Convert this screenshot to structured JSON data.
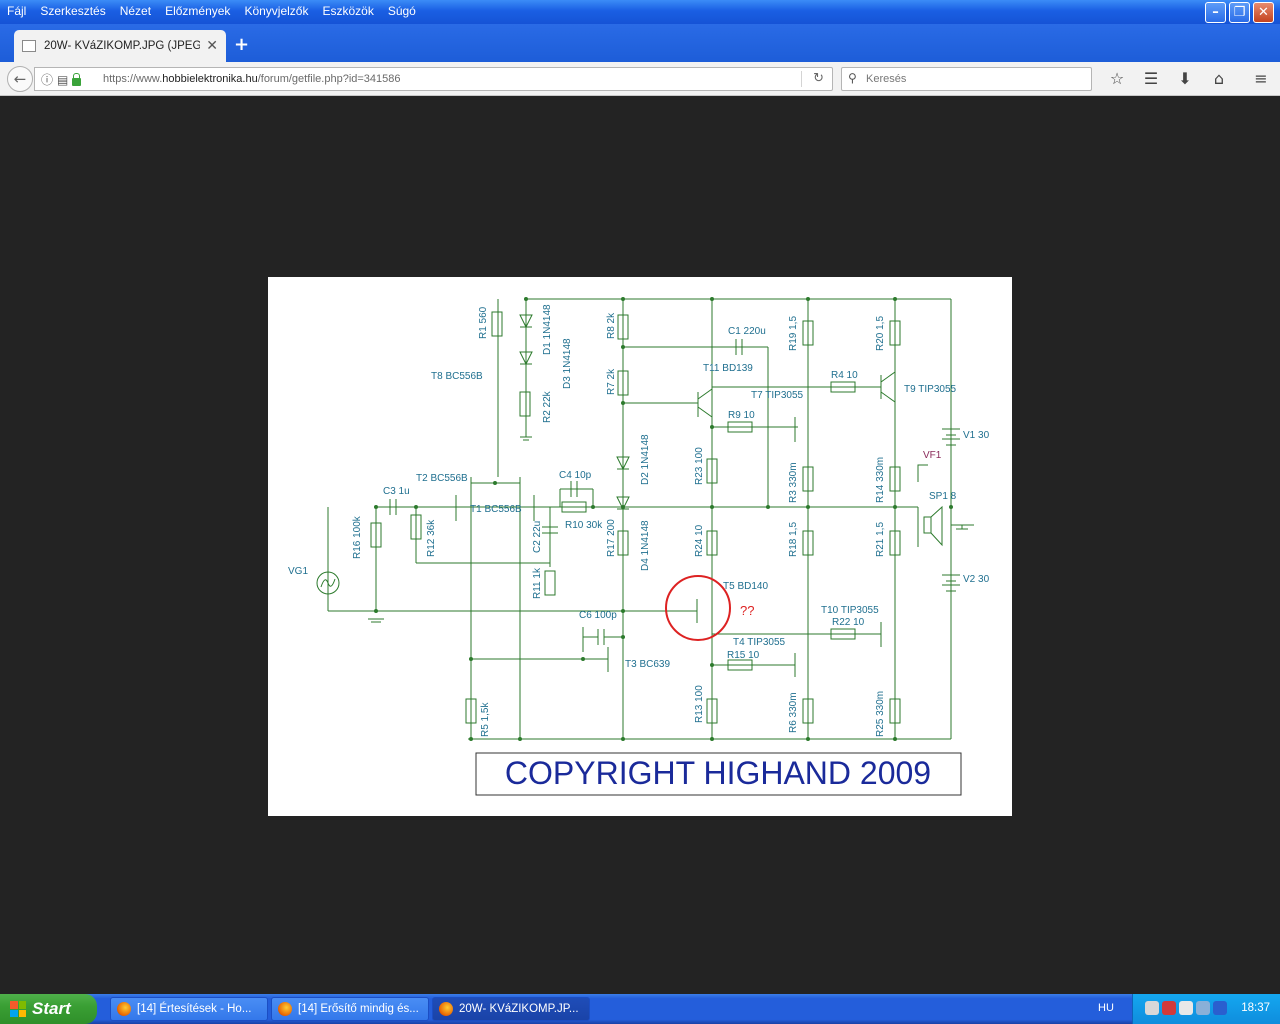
{
  "menu": [
    "Fájl",
    "Szerkesztés",
    "Nézet",
    "Előzmények",
    "Könyvjelzők",
    "Eszközök",
    "Súgó"
  ],
  "tab": {
    "title": "20W- KVáZIKOMP.JPG (JPEG ..."
  },
  "nav": {
    "url_prefix": "https://www.",
    "url_host": "hobbielektronika.hu",
    "url_path": "/forum/getfile.php?id=341586",
    "search_placeholder": "Keresés"
  },
  "schematic": {
    "copyright": "COPYRIGHT HIGHAND 2009",
    "mark": "??",
    "labels": [
      "R1 560",
      "D1 1N4148",
      "D3 1N4148",
      "T8 BC556B",
      "R2 22k",
      "R8 2k",
      "R7 2k",
      "C1 220u",
      "R19 1,5",
      "R20 1,5",
      "T11 BD139",
      "R4 10",
      "T9 TIP3055",
      "T7 TIP3055",
      "R9 10",
      "V1 30",
      "VF1",
      "R23 100",
      "D2 1N4148",
      "R3 330m",
      "R14 330m",
      "SP1 8",
      "T2 BC556B",
      "C3 1u",
      "C4 10p",
      "T1 BC556B",
      "R10 30k",
      "R16 100k",
      "R12 36k",
      "C2 22u",
      "R17 200",
      "R24 10",
      "R18 1,5",
      "R21 1,5",
      "VG1",
      "D4 1N4148",
      "T5 BD140",
      "V2 30",
      "R11 1k",
      "C6 100p",
      "T10 TIP3055",
      "R22 10",
      "T4 TIP3055",
      "R15 10",
      "T3 BC639",
      "R5 1,5k",
      "R13 100",
      "R6 330m",
      "R25 330m"
    ]
  },
  "taskbar": {
    "start": "Start",
    "items": [
      "[14] Értesítések - Ho...",
      "[14] Erősítő mindig és...",
      "20W- KVáZIKOMP.JP..."
    ],
    "lang": "HU",
    "clock": "18:37"
  },
  "colors": {
    "schematic_ink": "#2c7a2c",
    "label_ink": "#1f6f8f",
    "copyright": "#1a2a9a",
    "highlight": "#dd2222"
  }
}
